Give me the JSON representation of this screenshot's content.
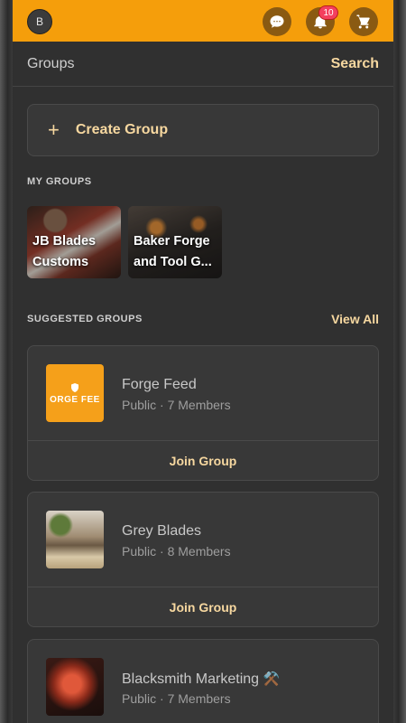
{
  "topbar": {
    "avatar_initial": "B",
    "notification_count": "10",
    "icons": [
      "chat-icon",
      "bell-icon",
      "cart-icon"
    ],
    "accent_color": "#f59e0b"
  },
  "header": {
    "title": "Groups",
    "search_label": "Search"
  },
  "create_group": {
    "icon": "+",
    "label": "Create Group"
  },
  "my_groups": {
    "heading": "MY GROUPS",
    "items": [
      {
        "name": "JB Blades Customs"
      },
      {
        "name": "Baker Forge and Tool G..."
      }
    ]
  },
  "suggested_groups": {
    "heading": "SUGGESTED GROUPS",
    "view_all_label": "View All",
    "items": [
      {
        "name": "Forge Feed",
        "meta": "Public · 7 Members",
        "thumb_text": "ORGE FEE",
        "join_label": "Join Group"
      },
      {
        "name": "Grey Blades",
        "meta": "Public · 8 Members",
        "join_label": "Join Group"
      },
      {
        "name": "Blacksmith Marketing",
        "name_suffix_icon": "⚒️",
        "meta": "Public · 7 Members"
      }
    ]
  }
}
